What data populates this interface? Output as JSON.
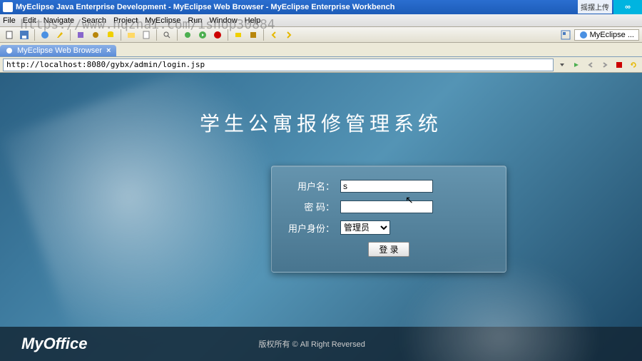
{
  "window": {
    "title": "MyEclipse Java Enterprise Development - MyEclipse Web Browser - MyEclipse Enterprise Workbench"
  },
  "menu": {
    "items": [
      "File",
      "Edit",
      "Navigate",
      "Search",
      "Project",
      "MyEclipse",
      "Run",
      "Window",
      "Help"
    ]
  },
  "watermark": "https://www.nqzhai.com/ishop30884",
  "tabs": {
    "browser": "MyEclipse Web Browser",
    "right": "MyEclipse ..."
  },
  "url": "http://localhost:8080/gybx/admin/login.jsp",
  "page": {
    "title": "学生公寓报修管理系统",
    "labels": {
      "user": "用户名：",
      "pass": "密  码：",
      "role": "用户身份："
    },
    "inputs": {
      "user": "s",
      "pass": "",
      "role": "管理员"
    },
    "button": "登 录"
  },
  "footer": {
    "logo1": "My",
    "logo2": "Office",
    "copyright": "版权所有 © All Right Reversed"
  },
  "corner": {
    "button": "∞",
    "text": "摇摆上传"
  }
}
